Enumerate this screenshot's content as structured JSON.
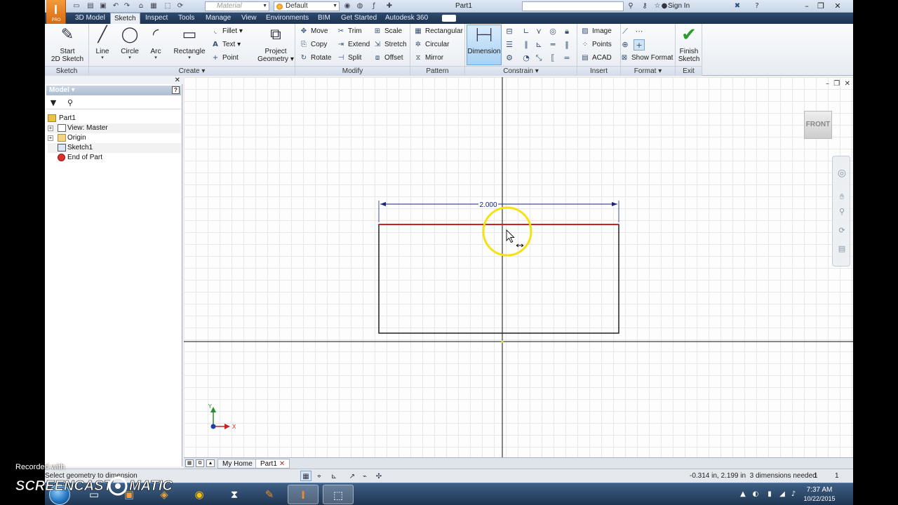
{
  "titlebar": {
    "material_placeholder": "Material",
    "appearance_value": "Default",
    "document_title": "Part1",
    "sign_in": "Sign In"
  },
  "tabs": [
    "3D Model",
    "Sketch",
    "Inspect",
    "Tools",
    "Manage",
    "View",
    "Environments",
    "BIM",
    "Get Started",
    "Autodesk 360"
  ],
  "ribbon": {
    "sketch_panel": {
      "label": "Sketch",
      "start_2d_sketch_l1": "Start",
      "start_2d_sketch_l2": "2D Sketch"
    },
    "create_panel": {
      "label": "Create",
      "line": "Line",
      "circle": "Circle",
      "arc": "Arc",
      "rectangle": "Rectangle",
      "fillet": "Fillet",
      "text": "Text",
      "point": "Point",
      "project_geometry_l1": "Project",
      "project_geometry_l2": "Geometry"
    },
    "modify_panel": {
      "label": "Modify",
      "move": "Move",
      "trim": "Trim",
      "scale": "Scale",
      "copy": "Copy",
      "extend": "Extend",
      "stretch": "Stretch",
      "rotate": "Rotate",
      "split": "Split",
      "offset": "Offset"
    },
    "pattern_panel": {
      "label": "Pattern",
      "rectangular": "Rectangular",
      "circular": "Circular",
      "mirror": "Mirror"
    },
    "constrain_panel": {
      "label": "Constrain",
      "dimension": "Dimension"
    },
    "insert_panel": {
      "label": "Insert",
      "image": "Image",
      "points": "Points",
      "acad": "ACAD"
    },
    "format_panel": {
      "label": "Format",
      "show_format": "Show Format"
    },
    "exit_panel": {
      "label": "Exit",
      "finish_sketch_l1": "Finish",
      "finish_sketch_l2": "Sketch"
    }
  },
  "browser": {
    "title": "Model",
    "tree": [
      "Part1",
      "View: Master",
      "Origin",
      "Sketch1",
      "End of Part"
    ]
  },
  "canvas": {
    "viewcube_face": "FRONT",
    "dimension_value": "2.000",
    "axis_x": "X",
    "axis_y": "Y"
  },
  "doctabs": {
    "home": "My Home",
    "part": "Part1"
  },
  "statusbar": {
    "message": "Select geometry to dimension",
    "coords": "-0.314 in, 2.199 in",
    "dims_needed": "3 dimensions needed",
    "val1": "1",
    "val2": "1"
  },
  "taskbar": {
    "time": "7:37 AM",
    "date": "10/22/2015"
  },
  "watermark": {
    "line1": "Recorded with",
    "brand": "SCREENCAST",
    "brand2": "MATIC"
  },
  "colors": {
    "accent_orange": "#e8842a",
    "sketch_highlight": "#cc2222",
    "cursor_ring": "#f5e214",
    "dimension_color": "#1a237e"
  }
}
